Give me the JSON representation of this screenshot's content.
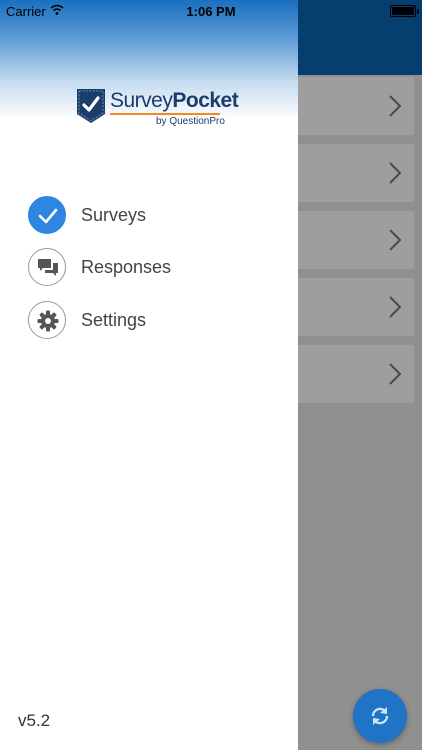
{
  "status_bar": {
    "carrier": "Carrier",
    "time": "1:06 PM"
  },
  "logo": {
    "name_part1": "Survey",
    "name_part2": "Pocket",
    "byline": "by QuestionPro"
  },
  "menu": {
    "items": [
      {
        "label": "Surveys",
        "icon": "check-icon",
        "active": true
      },
      {
        "label": "Responses",
        "icon": "chat-bubbles-icon",
        "active": false
      },
      {
        "label": "Settings",
        "icon": "gear-icon",
        "active": false
      }
    ]
  },
  "version": "v5.2",
  "colors": {
    "accent": "#2f86e0",
    "header_blue": "#0a66b3",
    "logo_orange": "#f08b1d"
  }
}
